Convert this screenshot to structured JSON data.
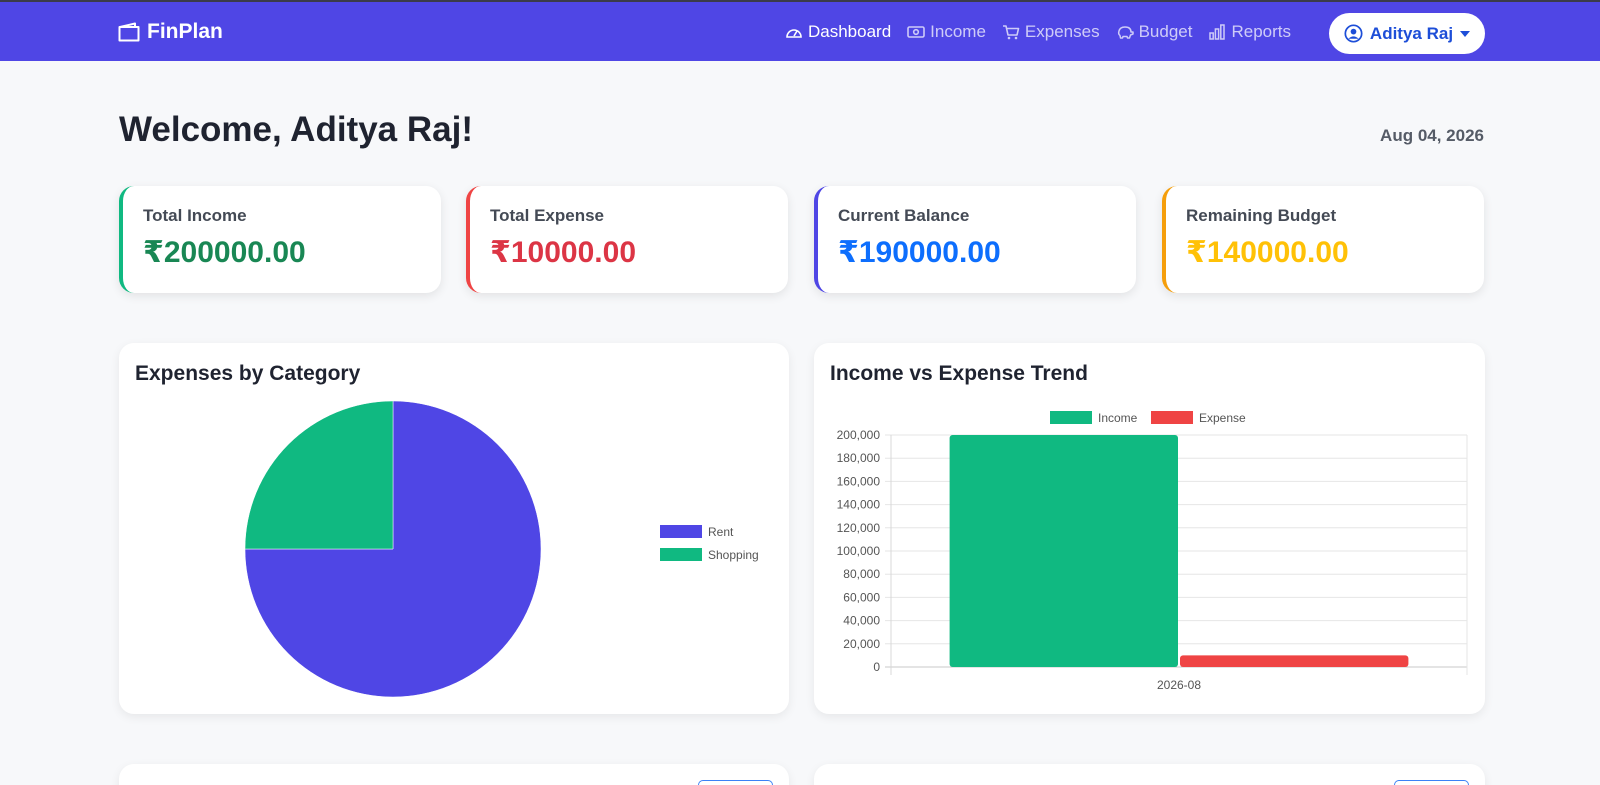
{
  "brand": {
    "name": "FinPlan"
  },
  "nav": {
    "items": [
      {
        "label": "Dashboard",
        "icon": "speedometer-icon",
        "active": true
      },
      {
        "label": "Income",
        "icon": "cash-icon"
      },
      {
        "label": "Expenses",
        "icon": "cart-icon"
      },
      {
        "label": "Budget",
        "icon": "piggy-bank-icon"
      },
      {
        "label": "Reports",
        "icon": "bar-chart-icon"
      }
    ],
    "user": "Aditya Raj"
  },
  "welcome": "Welcome, Aditya Raj!",
  "date": "Aug 04, 2026",
  "stats": [
    {
      "label": "Total Income",
      "value": "₹200000.00",
      "color": "#198754"
    },
    {
      "label": "Total Expense",
      "value": "₹10000.00",
      "color": "#dc3545"
    },
    {
      "label": "Current Balance",
      "value": "₹190000.00",
      "color": "#0d6efd"
    },
    {
      "label": "Remaining Budget",
      "value": "₹140000.00",
      "color": "#ffc107"
    }
  ],
  "stat_border_colors": [
    "#10b981",
    "#ef4444",
    "#4f46e5",
    "#f59e0b"
  ],
  "colors": {
    "accent": "#4f46e5",
    "income": "#10b981",
    "expense": "#ef4444"
  },
  "pie_card": {
    "title": "Expenses by Category"
  },
  "bar_card": {
    "title": "Income vs Expense Trend"
  },
  "chart_data": [
    {
      "type": "pie",
      "title": "Expenses by Category",
      "labels": [
        "Rent",
        "Shopping"
      ],
      "values": [
        7500,
        2500
      ],
      "colors": [
        "#4f46e5",
        "#10b981"
      ],
      "legend": "right"
    },
    {
      "type": "bar",
      "title": "Income vs Expense Trend",
      "categories": [
        "2026-08"
      ],
      "series": [
        {
          "name": "Income",
          "values": [
            200000
          ],
          "color": "#10b981"
        },
        {
          "name": "Expense",
          "values": [
            10000
          ],
          "color": "#ef4444"
        }
      ],
      "ylim": [
        0,
        200000
      ],
      "yticks": [
        "0",
        "20,000",
        "40,000",
        "60,000",
        "80,000",
        "100,000",
        "120,000",
        "140,000",
        "160,000",
        "180,000",
        "200,000"
      ],
      "grid": true,
      "legend": "top"
    }
  ]
}
